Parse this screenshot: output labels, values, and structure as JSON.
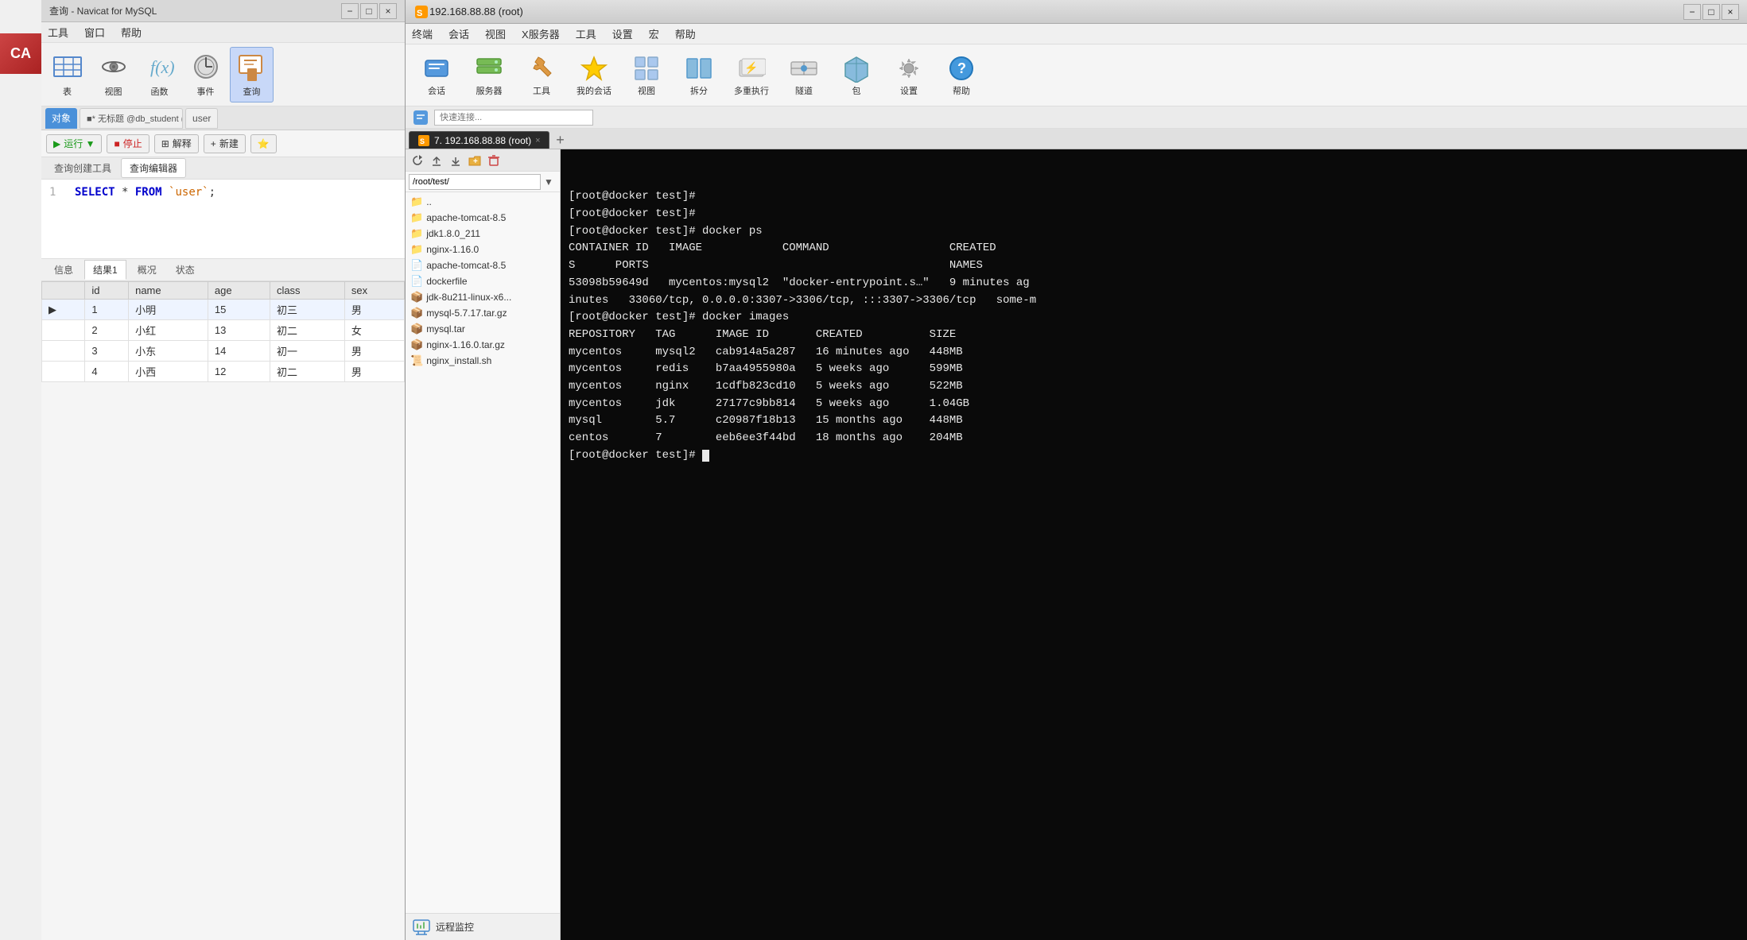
{
  "navicat": {
    "title": "查询 - Navicat for MySQL",
    "menu": [
      "工具",
      "窗口",
      "帮助"
    ],
    "toolbar_buttons": [
      {
        "label": "表",
        "icon": "table"
      },
      {
        "label": "视图",
        "icon": "view"
      },
      {
        "label": "函数",
        "icon": "function"
      },
      {
        "label": "事件",
        "icon": "event"
      },
      {
        "label": "查询",
        "icon": "query"
      }
    ],
    "tabs": [
      {
        "label": "对象",
        "active": true
      },
      {
        "label": "■* 无标题 @db_student (ww) ...",
        "active": false
      },
      {
        "label": "user",
        "active": false
      }
    ],
    "query_toolbar": [
      {
        "label": "▶ 运行 ▼"
      },
      {
        "label": "■ 停止"
      },
      {
        "label": "⊞ 解释"
      },
      {
        "label": "+ 新建"
      }
    ],
    "subtabs": [
      "查询创建工具",
      "查询编辑器"
    ],
    "query": "SELECT * FROM `user`;",
    "line_num": "1",
    "result_tabs": [
      "信息",
      "结果1",
      "概况",
      "状态"
    ],
    "result_columns": [
      "id",
      "name",
      "age",
      "class",
      "sex"
    ],
    "result_rows": [
      {
        "id": "1",
        "name": "小明",
        "age": "15",
        "class": "初三",
        "sex": "男"
      },
      {
        "id": "2",
        "name": "小红",
        "age": "13",
        "class": "初二",
        "sex": "女"
      },
      {
        "id": "3",
        "name": "小东",
        "age": "14",
        "class": "初一",
        "sex": "男"
      },
      {
        "id": "4",
        "name": "小西",
        "age": "12",
        "class": "初二",
        "sex": "男"
      }
    ]
  },
  "securecrt": {
    "title": "192.168.88.88 (root)",
    "menu": [
      "终端",
      "会话",
      "视图",
      "X服务器",
      "工具",
      "设置",
      "宏",
      "帮助"
    ],
    "toolbar_buttons": [
      {
        "label": "会话",
        "icon": "session"
      },
      {
        "label": "服务器",
        "icon": "server"
      },
      {
        "label": "工具",
        "icon": "tools"
      },
      {
        "label": "我的会话",
        "icon": "mysession"
      },
      {
        "label": "视图",
        "icon": "view"
      },
      {
        "label": "拆分",
        "icon": "split"
      },
      {
        "label": "多重执行",
        "icon": "multiexec"
      },
      {
        "label": "隧道",
        "icon": "tunnel"
      },
      {
        "label": "包",
        "icon": "package"
      },
      {
        "label": "设置",
        "icon": "settings"
      },
      {
        "label": "帮助",
        "icon": "help"
      }
    ],
    "session_placeholder": "快速连接...",
    "session_tab": "7. 192.168.88.88 (root)",
    "file_panel": {
      "path": "/root/test/",
      "items": [
        {
          "name": "..",
          "type": "parent"
        },
        {
          "name": "apache-tomcat-8.5",
          "type": "folder"
        },
        {
          "name": "jdk1.8.0_211",
          "type": "folder"
        },
        {
          "name": "nginx-1.16.0",
          "type": "folder"
        },
        {
          "name": "apache-tomcat-8.5",
          "type": "file"
        },
        {
          "name": "dockerfile",
          "type": "file"
        },
        {
          "name": "jdk-8u211-linux-x6...",
          "type": "file"
        },
        {
          "name": "mysql-5.7.17.tar.gz",
          "type": "file"
        },
        {
          "name": "mysql.tar",
          "type": "file"
        },
        {
          "name": "nginx-1.16.0.tar.gz",
          "type": "file"
        },
        {
          "name": "nginx_install.sh",
          "type": "script"
        }
      ],
      "remote_monitor": "远程监控"
    },
    "terminal": {
      "lines": [
        "[root@docker test]#",
        "[root@docker test]#",
        "[root@docker test]# docker ps",
        "CONTAINER ID   IMAGE            COMMAND                  CREATED",
        "S      PORTS                                             NAMES",
        "53098b59649d   mycentos:mysql2  \"docker-entrypoint.s…\"   9 minutes ag",
        "inutes   33060/tcp, 0.0.0.0:3307->3306/tcp, :::3307->3306/tcp   some-m",
        "[root@docker test]# docker images",
        "REPOSITORY   TAG      IMAGE ID       CREATED          SIZE",
        "mycentos     mysql2   cab914a5a287   16 minutes ago   448MB",
        "mycentos     redis    b7aa4955980a   5 weeks ago      599MB",
        "mycentos     nginx    1cdfb823cd10   5 weeks ago      522MB",
        "mycentos     jdk      27177c9bb814   5 weeks ago      1.04GB",
        "mysql        5.7      c20987f18b13   15 months ago    448MB",
        "centos       7        eeb6ee3f44bd   18 months ago    204MB",
        "[root@docker test]# "
      ]
    }
  },
  "ca_badge": "CA"
}
